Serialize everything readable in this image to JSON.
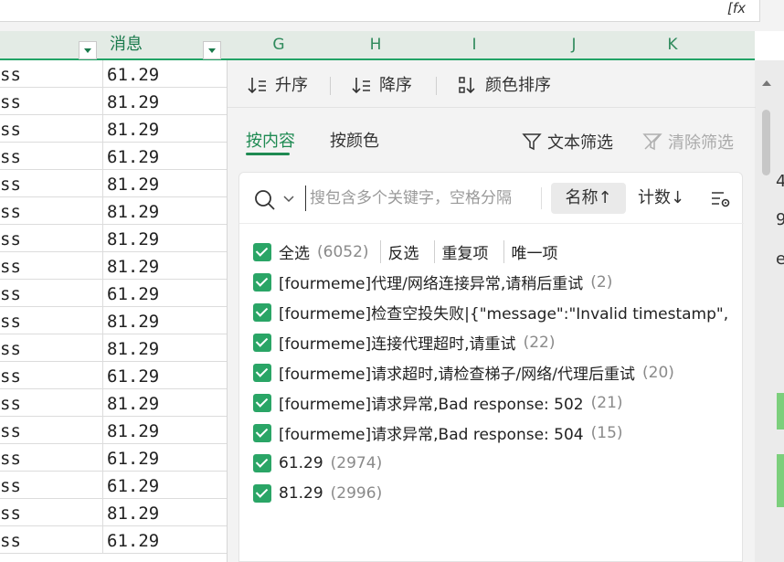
{
  "formula_bar": {
    "fx_label": "fx"
  },
  "header": {
    "col_f_label": "消息",
    "columns": [
      "G",
      "H",
      "I",
      "J",
      "K"
    ]
  },
  "grid": {
    "col_a_text": "ss",
    "values": [
      "61.29",
      "81.29",
      "81.29",
      "61.29",
      "81.29",
      "81.29",
      "81.29",
      "81.29",
      "61.29",
      "81.29",
      "81.29",
      "61.29",
      "81.29",
      "81.29",
      "61.29",
      "61.29",
      "81.29",
      "61.29"
    ]
  },
  "edge": {
    "text1": "4",
    "text2": "9",
    "text3": "e"
  },
  "panel": {
    "sort": {
      "asc": "升序",
      "desc": "降序",
      "color_sort": "颜色排序"
    },
    "tabs": {
      "by_content": "按内容",
      "by_color": "按颜色"
    },
    "tools": {
      "text_filter": "文本筛选",
      "clear_filter": "清除筛选"
    },
    "search": {
      "placeholder": "搜包含多个关键字，空格分隔",
      "name_sort": "名称↑",
      "count_sort": "计数↓"
    },
    "select_all": {
      "label": "全选",
      "count": "(6052)",
      "invert": "反选",
      "duplicates": "重复项",
      "unique": "唯一项"
    },
    "items": [
      {
        "label": "[fourmeme]代理/网络连接异常,请稍后重试",
        "count": "(2)"
      },
      {
        "label": "[fourmeme]检查空投失败|{\"message\":\"Invalid timestamp\",",
        "count": ""
      },
      {
        "label": "[fourmeme]连接代理超时,请重试",
        "count": "(22)"
      },
      {
        "label": "[fourmeme]请求超时,请检查梯子/网络/代理后重试",
        "count": "(20)"
      },
      {
        "label": "[fourmeme]请求异常,Bad response: 502",
        "count": "(21)"
      },
      {
        "label": "[fourmeme]请求异常,Bad response: 504",
        "count": "(15)"
      },
      {
        "label": "61.29",
        "count": "(2974)"
      },
      {
        "label": "81.29",
        "count": "(2996)"
      }
    ]
  },
  "colors": {
    "accent": "#1e8a52",
    "checkbox": "#2aa566",
    "header_bg": "#e3ebe5"
  }
}
